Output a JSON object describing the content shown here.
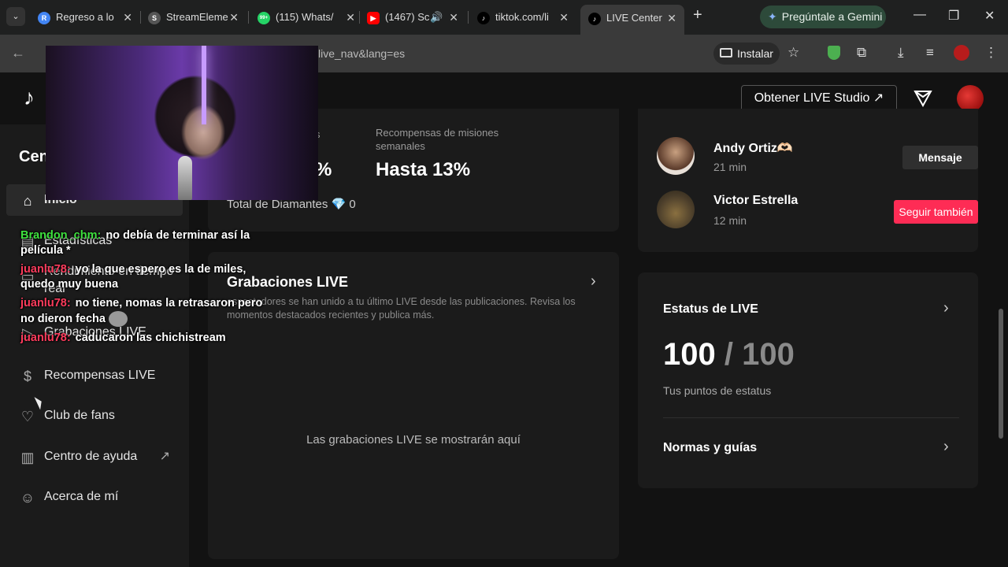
{
  "browser": {
    "tabs": [
      {
        "label": "Regreso a lo",
        "favicon": "R",
        "color": "#4285f4"
      },
      {
        "label": "StreamEleme",
        "favicon": "S",
        "color": "#555555"
      },
      {
        "label": "(115) Whats/",
        "favicon": "99+",
        "color": "#25d366"
      },
      {
        "label": "(1467) Sc",
        "favicon": "▶",
        "color": "#ff0000"
      },
      {
        "label": "tiktok.com/li",
        "favicon": "♪",
        "color": "#000000"
      },
      {
        "label": "LIVE Center",
        "favicon": "♪",
        "color": "#000000"
      }
    ],
    "gemini_label": "Pregúntale a Gemini",
    "url_visible": "live_nav&lang=es",
    "install_label": "Instalar"
  },
  "topbar": {
    "studio_button": "Obtener LIVE Studio ↗"
  },
  "sidebar": {
    "title": "Cen",
    "items": [
      {
        "label": "Inicio",
        "icon": "home-icon",
        "glyph": "⌂"
      },
      {
        "label": "Estadísticas",
        "icon": "chart-icon",
        "glyph": "▤"
      },
      {
        "label": "Rendimiento en tiempo real",
        "icon": "monitor-icon",
        "glyph": "▭"
      },
      {
        "label": "Grabaciones LIVE",
        "icon": "video-icon",
        "glyph": "▷"
      },
      {
        "label": "Recompensas LIVE",
        "icon": "coin-icon",
        "glyph": "$"
      },
      {
        "label": "Club de fans",
        "icon": "heart-icon",
        "glyph": "♡"
      },
      {
        "label": "Centro de ayuda",
        "icon": "book-icon",
        "glyph": "▥",
        "external": "↗"
      },
      {
        "label": "Acerca de mí",
        "icon": "person-icon",
        "glyph": "☺"
      }
    ]
  },
  "stats_card": {
    "left_label_partial": "s",
    "left_value_partial": "%",
    "mission_label": "Recompensas de misiones semanales",
    "mission_value": "Hasta 13%",
    "diamonds_label": "Total de Diamantes 💎 0"
  },
  "recordings": {
    "title": "Grabaciones LIVE",
    "description": "espectadores se han unido a tu último LIVE desde las publicaciones. Revisa los momentos destacados recientes y publica más.",
    "empty": "Las grabaciones LIVE se mostrarán aquí"
  },
  "followers": [
    {
      "name": "Andy Ortiz🫶🏻",
      "time": "21 min",
      "button": "Mensaje",
      "avatar_color": "#5a3a2a"
    },
    {
      "name": "Victor Estrella",
      "time": "12 min",
      "button": "Seguir también",
      "avatar_color": "#4a3d2a"
    }
  ],
  "live_status": {
    "title": "Estatus de LIVE",
    "score": "100",
    "max": "/ 100",
    "subtitle": "Tus puntos de estatus",
    "guides": "Normas y guías"
  },
  "chat": [
    {
      "user": "Brandon_chm:",
      "color": "#3ee03e",
      "text": "no debía de terminar así la película *"
    },
    {
      "user": "juanlu78:",
      "color": "#ff3b5c",
      "text": "yo la que espero es la de miles, quedo muy buena"
    },
    {
      "user": "juanlu78:",
      "color": "#ff3b5c",
      "text": "no tiene, nomas la retrasaron pero no dieron fecha"
    },
    {
      "user": "juanlu78:",
      "color": "#ff3b5c",
      "text": "caducaron las chichistream"
    }
  ],
  "colors": {
    "accent": "#fe2c55",
    "card_bg": "#1b1b1b",
    "page_bg": "#121212"
  }
}
